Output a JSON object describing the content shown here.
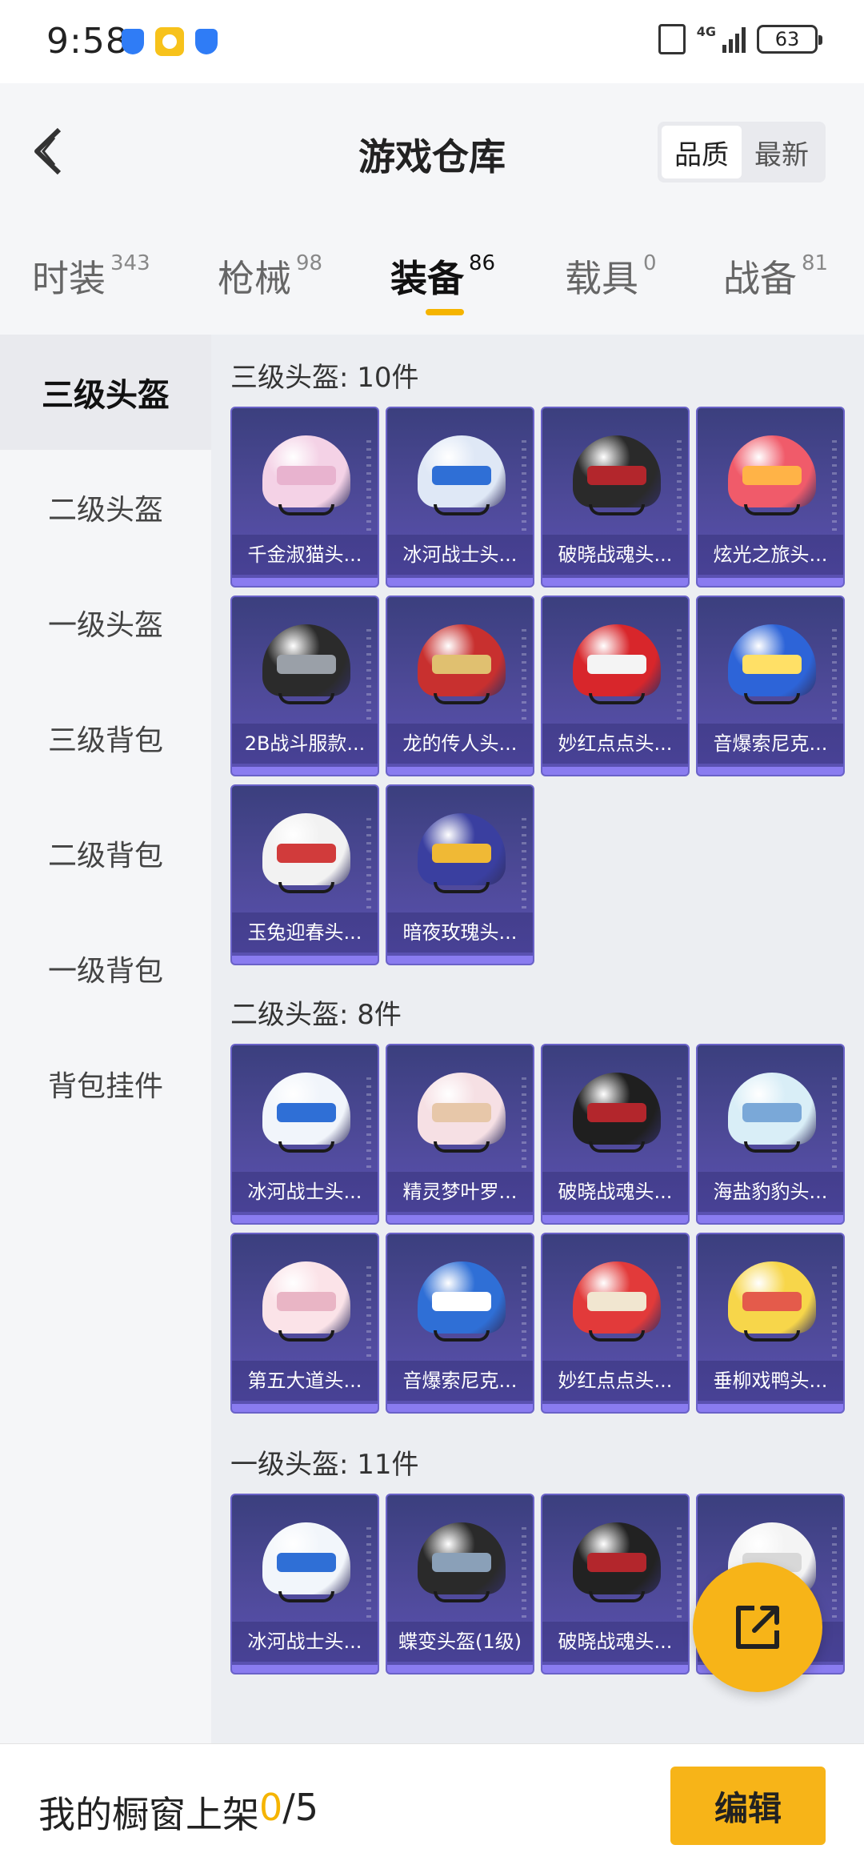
{
  "status_bar": {
    "time": "9:58",
    "network": "4G",
    "battery": "63"
  },
  "header": {
    "title": "游戏仓库",
    "sort_options": [
      "品质",
      "最新"
    ],
    "active_sort": "品质"
  },
  "tabs": [
    {
      "label": "时装",
      "count": "343"
    },
    {
      "label": "枪械",
      "count": "98"
    },
    {
      "label": "装备",
      "count": "86"
    },
    {
      "label": "载具",
      "count": "0"
    },
    {
      "label": "战备",
      "count": "81"
    }
  ],
  "active_tab": "装备",
  "sidebar": {
    "items": [
      "三级头盔",
      "二级头盔",
      "一级头盔",
      "三级背包",
      "二级背包",
      "一级背包",
      "背包挂件"
    ],
    "active": "三级头盔"
  },
  "sections": [
    {
      "title": "三级头盔: 10件",
      "items": [
        "千金淑猫头...",
        "冰河战士头...",
        "破晓战魂头...",
        "炫光之旅头...",
        "2B战斗服款...",
        "龙的传人头...",
        "妙红点点头...",
        "音爆索尼克...",
        "玉兔迎春头...",
        "暗夜玫瑰头..."
      ]
    },
    {
      "title": "二级头盔: 8件",
      "items": [
        "冰河战士头...",
        "精灵梦叶罗...",
        "破晓战魂头...",
        "海盐豹豹头...",
        "第五大道头...",
        "音爆索尼克...",
        "妙红点点头...",
        "垂柳戏鸭头..."
      ]
    },
    {
      "title": "一级头盔: 11件",
      "items": [
        "冰河战士头...",
        "蝶变头盔(1级)",
        "破晓战魂头...",
        ""
      ]
    }
  ],
  "bottom_bar": {
    "showcase_label": "我的橱窗上架 ",
    "showcase_count": "0",
    "showcase_total": "/5",
    "edit_label": "编辑"
  },
  "colors": {
    "accent": "#f7b418",
    "card_bg": "#4f4a9a"
  }
}
